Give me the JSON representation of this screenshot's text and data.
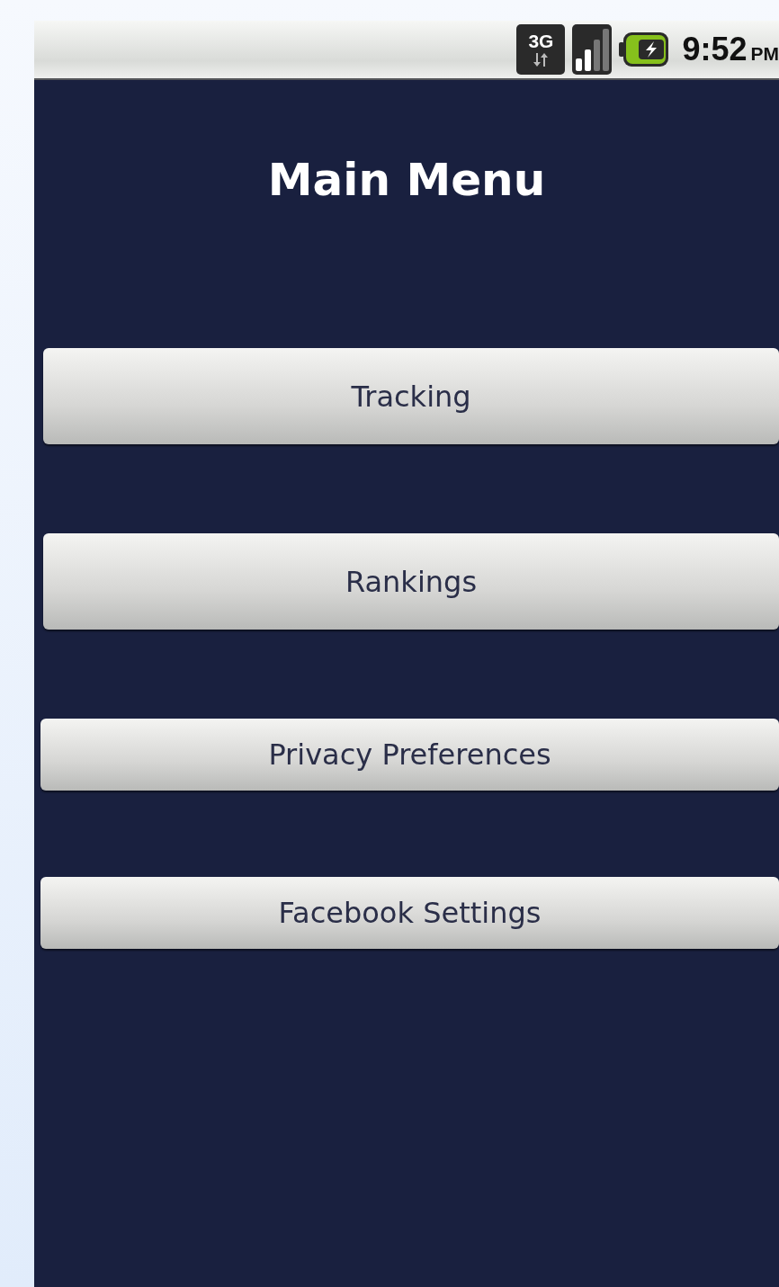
{
  "status_bar": {
    "network": "3G",
    "time": "9:52",
    "meridiem": "PM"
  },
  "title": "Main Menu",
  "buttons": [
    {
      "label": "Tracking",
      "kind": "large"
    },
    {
      "label": "Rankings",
      "kind": "large"
    },
    {
      "label": "Privacy Preferences",
      "kind": "small"
    },
    {
      "label": "Facebook Settings",
      "kind": "small"
    }
  ]
}
